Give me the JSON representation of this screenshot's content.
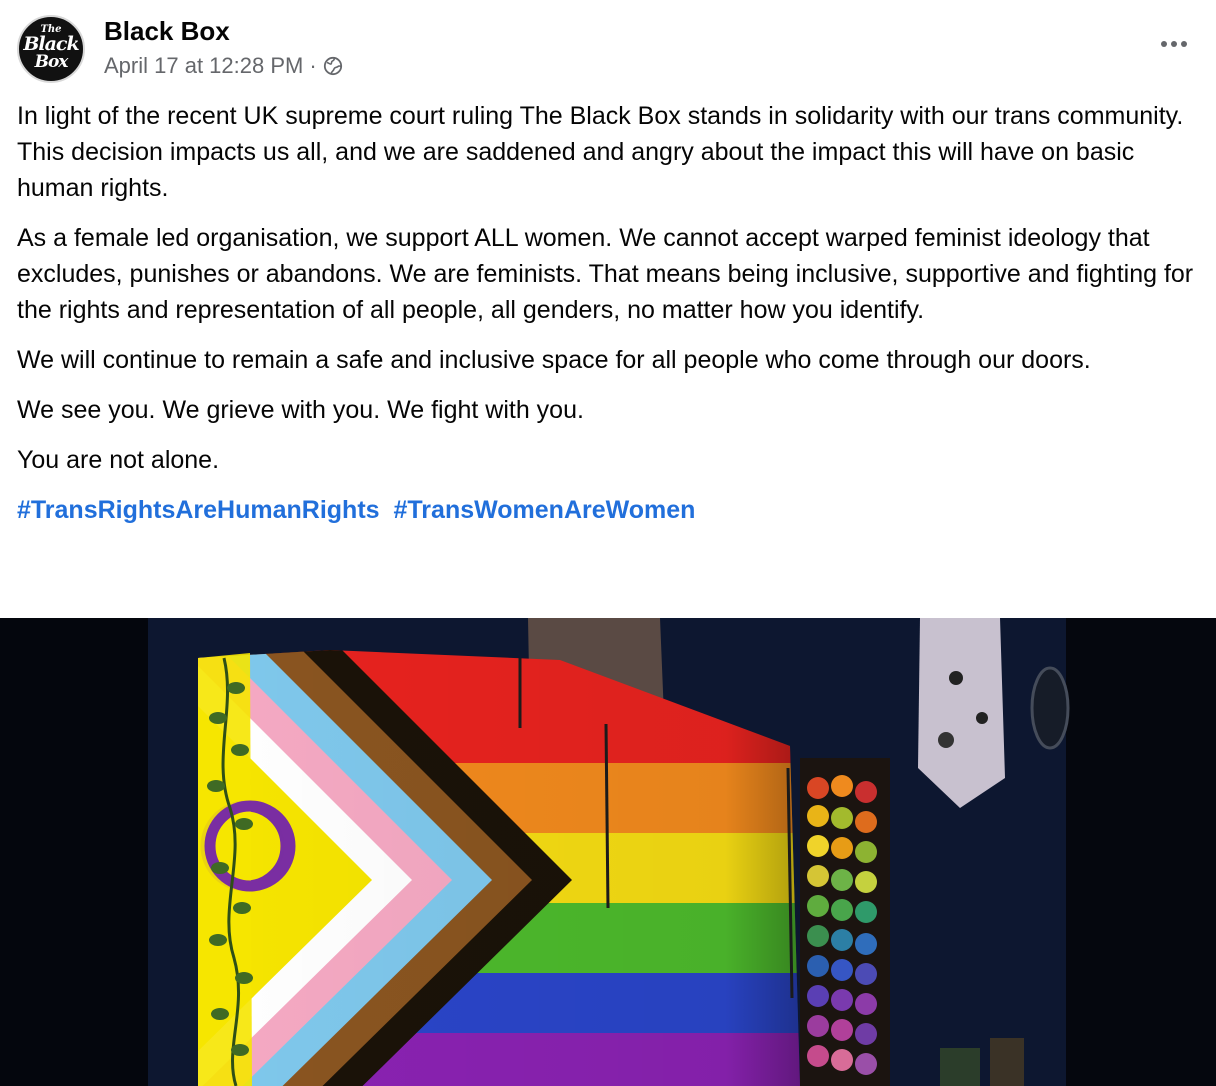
{
  "post": {
    "page_name": "Black Box",
    "avatar_text": {
      "line1": "The",
      "line2": "Black",
      "line3": "Box"
    },
    "date": "April 17 at 12:28 PM",
    "separator": "·",
    "audience_icon": "globe-icon",
    "more_icon": "more-options-icon",
    "paragraphs": [
      "In light of the recent UK supreme court ruling The Black Box stands in solidarity with our trans community. This decision impacts us all, and we are saddened and angry about the impact this will have on basic human rights.",
      "As a female led organisation, we support ALL women. We cannot accept warped feminist ideology that excludes, punishes or abandons. We are feminists. That means being inclusive, supportive and fighting for the rights and representation of all people, all genders, no matter how you identify.",
      "We will continue to remain a safe and inclusive space for all people who come through our doors.",
      "We see you. We grieve with you. We fight with you.",
      "You are not alone."
    ],
    "hashtags": [
      "#TransRightsAreHumanRights",
      "#TransWomenAreWomen"
    ],
    "photo": {
      "subject": "progress-pride-flag",
      "rainbow_colors": [
        "#e8231f",
        "#f28a1d",
        "#f5dc13",
        "#4dba2c",
        "#2a45c9",
        "#8a22b2"
      ]
    }
  },
  "colors": {
    "text": "#050505",
    "secondary": "#65676b",
    "link": "#216fdb"
  }
}
